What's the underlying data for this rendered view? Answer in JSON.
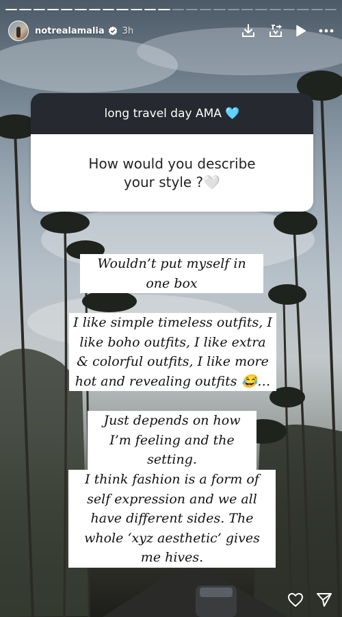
{
  "story": {
    "username": "notrealamalia",
    "time_ago": "3h",
    "progress": {
      "segments_total": 24,
      "segments_done": 12
    }
  },
  "question_sticker": {
    "title": "long travel day AMA 🩵",
    "question": "How would you describe your style ?🤍"
  },
  "answers": [
    "Wouldn’t put myself in one box",
    "I like simple timeless outfits, I like boho outfits, I like extra & colorful outfits, I like more hot and revealing outfits 😂…",
    "Just depends on how I’m feeling and the setting.",
    "I think fashion is a form of self expression and we all have different sides. The whole ‘xyz aesthetic’ gives me hives."
  ],
  "icons": {
    "header": [
      "verified-badge-icon",
      "download-icon",
      "add-to-highlight-icon",
      "play-icon",
      "more-icon"
    ],
    "footer": [
      "heart-icon",
      "send-icon"
    ]
  }
}
